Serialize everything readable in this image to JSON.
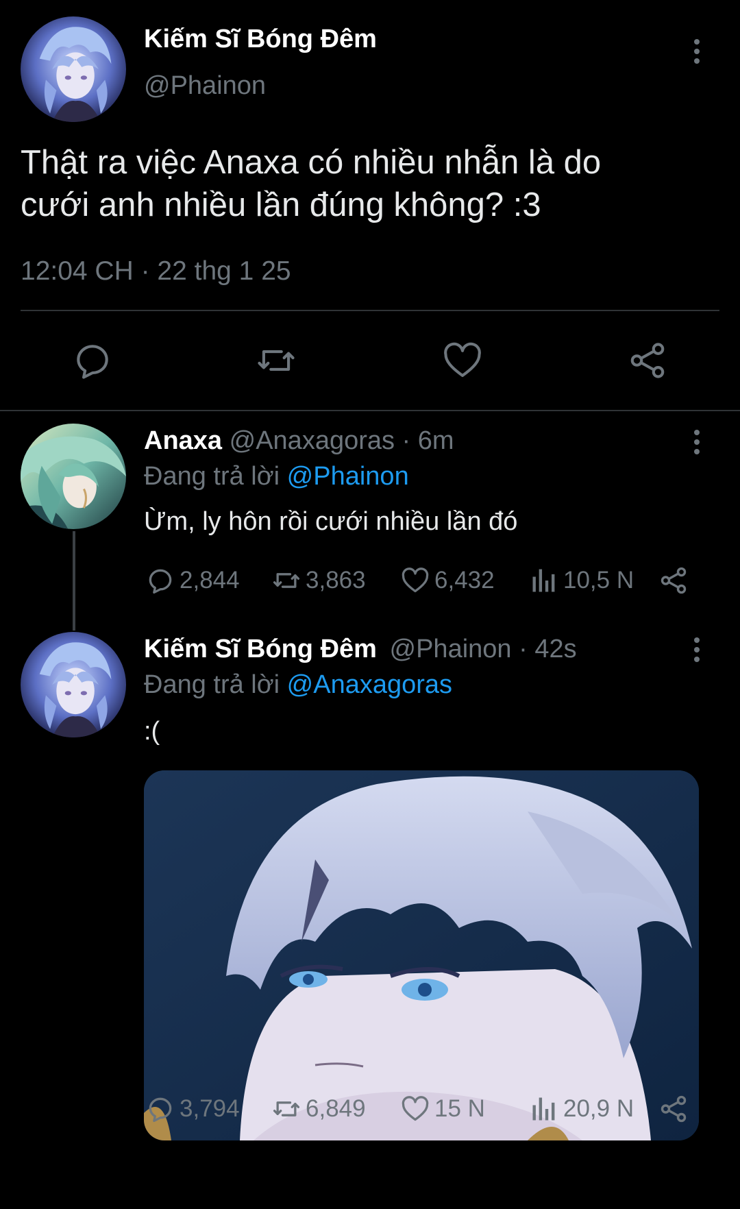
{
  "main_tweet": {
    "display_name": "Kiếm Sĩ Bóng Đêm",
    "handle": "@Phainon",
    "text_line1": "Thật ra việc Anaxa có nhiều nhẫn là do",
    "text_line2": "cưới anh nhiều lần đúng không? :3",
    "timestamp": "12:04 CH · 22 thg 1 25",
    "actions": [
      "reply-icon",
      "retweet-icon",
      "like-icon",
      "share-icon"
    ]
  },
  "reply1": {
    "display_name": "Anaxa",
    "handle_time": "@Anaxagoras · 6m",
    "replying_prefix": "Đang trả lời",
    "replying_to": "@Phainon",
    "text": "Ừm, ly hôn rồi cưới nhiều lần đó",
    "stats": {
      "replies": "2,844",
      "retweets": "3,863",
      "likes": "6,432",
      "views": "10,5 N"
    }
  },
  "reply2": {
    "display_name": "Kiếm Sĩ Bóng Đêm",
    "handle_time": "@Phainon · 42s",
    "replying_prefix": "Đang trả lời",
    "replying_to": "@Anaxagoras",
    "text": ":(",
    "stats": {
      "replies": "3,794",
      "retweets": "6,849",
      "likes": "15 N",
      "views": "20,9 N"
    }
  },
  "colors": {
    "background": "#000000",
    "text": "#e7e9ea",
    "muted": "#6e767d",
    "link": "#1d9bf0",
    "divider": "#2f3336"
  }
}
